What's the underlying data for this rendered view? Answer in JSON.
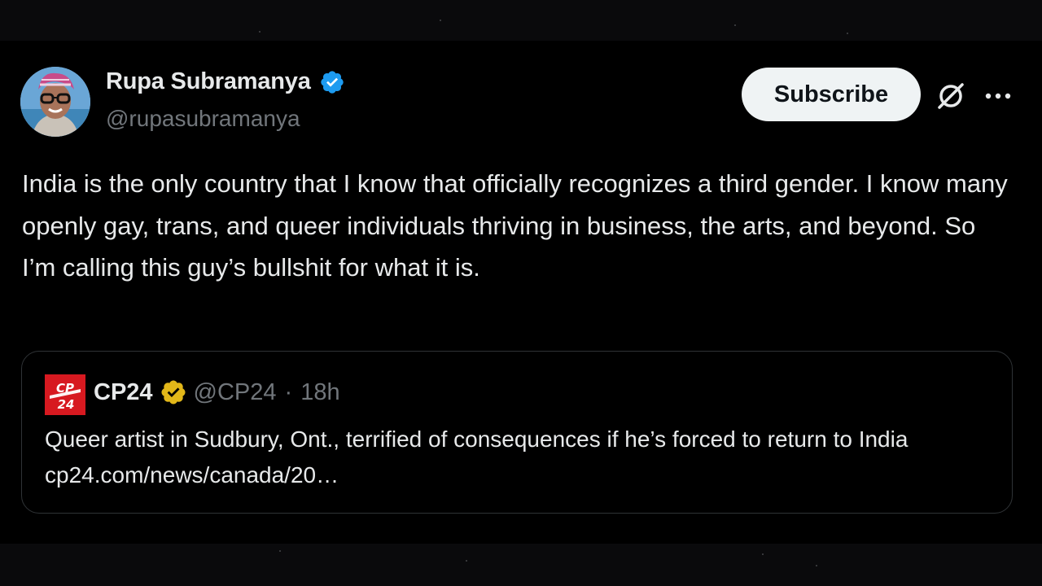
{
  "author": {
    "name": "Rupa Subramanya",
    "handle": "@rupasubramanya",
    "verified_icon": "blue-verified-badge",
    "verified_color": "#1d9bf0"
  },
  "actions": {
    "subscribe_label": "Subscribe",
    "grok_icon": "grok-icon",
    "more_icon": "more-horizontal-icon",
    "more_label": "···"
  },
  "tweet": {
    "text": "India is the only country that I know that officially recognizes a third gender. I know many openly gay, trans, and queer individuals thriving in business, the arts, and beyond. So I’m calling this guy’s bullshit for what it is."
  },
  "quote": {
    "logo_text": "CP24",
    "name": "CP24",
    "badge_icon": "gold-verified-badge",
    "badge_color": "#e2b719",
    "handle": "@CP24",
    "separator": "·",
    "time": "18h",
    "text": "Queer artist in Sudbury, Ont., terrified of consequences if he’s forced to return to India cp24.com/news/canada/20…"
  },
  "colors": {
    "background": "#000000",
    "text_primary": "#e7e9ea",
    "text_secondary": "#71767b",
    "border": "#2f3336",
    "brand_red": "#d71920"
  }
}
